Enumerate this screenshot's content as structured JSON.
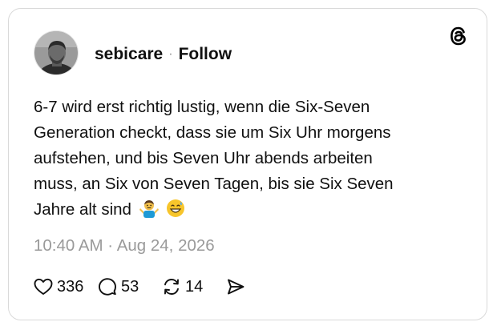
{
  "post": {
    "username": "sebicare",
    "separator": "·",
    "follow_label": "Follow",
    "text_lines": [
      "6-7 wird erst richtig lustig, wenn die Six-Seven",
      "Generation checkt, dass sie um Six Uhr morgens",
      "aufstehen, und bis Seven Uhr abends arbeiten",
      "muss, an Six von Seven Tagen, bis sie Six Seven",
      "Jahre alt sind"
    ],
    "emojis": [
      "man-shrugging-emoji",
      "grinning-sweat-emoji"
    ],
    "timestamp": "10:40 AM · Aug 24, 2026",
    "likes": "336",
    "replies": "53",
    "reposts": "14"
  },
  "icons": {
    "brand": "threads-logo-icon",
    "like": "heart-icon",
    "reply": "speech-bubble-icon",
    "repost": "repost-icon",
    "share": "send-icon"
  },
  "colors": {
    "text": "#101010",
    "muted": "#9a9a9a",
    "border": "#d9d9d9"
  }
}
